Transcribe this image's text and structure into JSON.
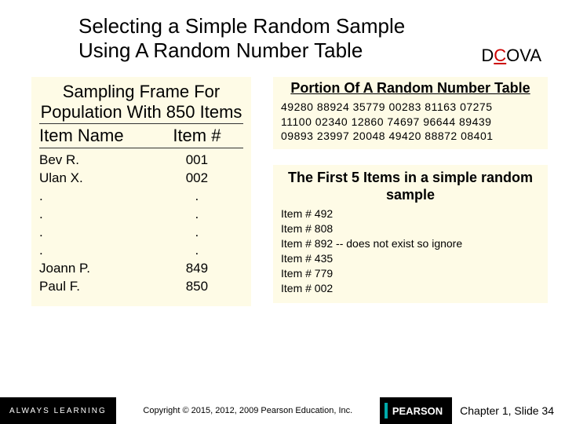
{
  "title_line1": "Selecting a Simple Random Sample",
  "title_line2": "Using A Random Number Table",
  "dcova": {
    "d": "D",
    "c": "C",
    "ova": "OVA"
  },
  "frame": {
    "caption": "Sampling Frame For Population With 850 Items",
    "col1": "Item Name",
    "col2": "Item #",
    "rows": [
      {
        "name": "Bev R.",
        "num": "001"
      },
      {
        "name": "Ulan X.",
        "num": "002"
      },
      {
        "name": ".",
        "num": "."
      },
      {
        "name": ".",
        "num": "."
      },
      {
        "name": ".",
        "num": "."
      },
      {
        "name": ".",
        "num": "."
      },
      {
        "name": "Joann P.",
        "num": "849"
      },
      {
        "name": "Paul F.",
        "num": "850"
      }
    ]
  },
  "rnt": {
    "title": "Portion Of A Random Number Table",
    "lines": [
      "49280 88924 35779 00283 81163 07275",
      "11100 02340 12860 74697 96644 89439",
      "09893 23997 20048 49420 88872 08401"
    ]
  },
  "sample": {
    "title": "The First 5 Items in a simple random sample",
    "items": [
      "Item # 492",
      "Item # 808",
      "Item # 892  --  does not exist so ignore",
      "Item # 435",
      "Item # 779",
      "Item # 002"
    ]
  },
  "footer": {
    "always": "ALWAYS LEARNING",
    "copyright": "Copyright © 2015, 2012, 2009 Pearson Education, Inc.",
    "pearson": "PEARSON",
    "slide": "Chapter 1, Slide 34"
  }
}
